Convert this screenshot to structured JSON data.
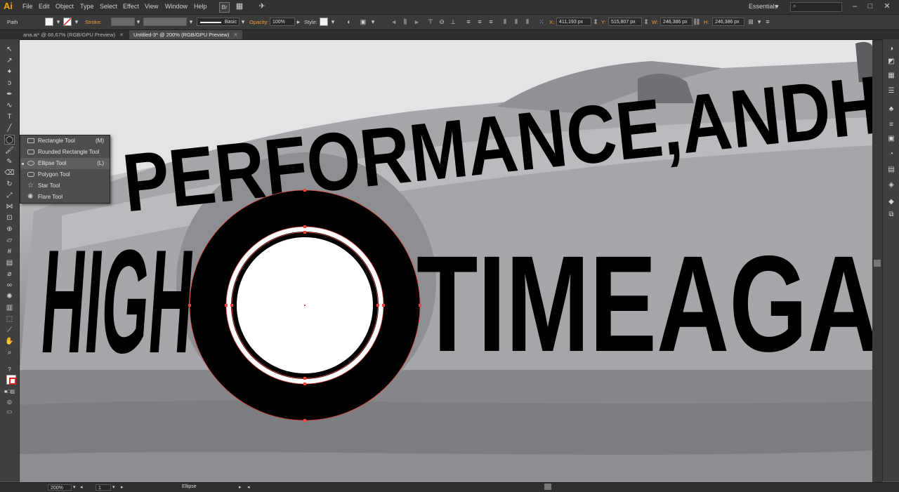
{
  "app": {
    "logo": "Ai"
  },
  "menu": [
    "File",
    "Edit",
    "Object",
    "Type",
    "Select",
    "Effect",
    "View",
    "Window",
    "Help"
  ],
  "menubar_extras": {
    "bridge": "Br",
    "workspace": "Essentials",
    "search_placeholder": ""
  },
  "control": {
    "selection_label": "Path",
    "stroke_label": "Stroke:",
    "stroke_style": "Basic",
    "opacity_label": "Opacity:",
    "opacity_value": "100%",
    "style_label": "Style:",
    "x_label": "X:",
    "x_value": "411,193 px",
    "y_label": "Y:",
    "y_value": "515,807 px",
    "w_label": "W:",
    "w_value": "246,386 px",
    "h_label": "H:",
    "h_value": "246,386 px"
  },
  "tabs": [
    {
      "label": "ana.ai* @ 66,67% (RGB/GPU Preview)",
      "active": false
    },
    {
      "label": "Untitled-3* @ 200% (RGB/GPU Preview)",
      "active": true
    }
  ],
  "flyout": [
    {
      "label": "Rectangle Tool",
      "shortcut": "(M)"
    },
    {
      "label": "Rounded Rectangle Tool",
      "shortcut": ""
    },
    {
      "label": "Ellipse Tool",
      "shortcut": "(L)"
    },
    {
      "label": "Polygon Tool",
      "shortcut": ""
    },
    {
      "label": "Star Tool",
      "shortcut": ""
    },
    {
      "label": "Flare Tool",
      "shortcut": ""
    }
  ],
  "artwork": {
    "line1": "PERFORMANCE,ANDHI",
    "line2_left": "HIGH",
    "line2_right": "TIMEAGA"
  },
  "status": {
    "zoom": "200%",
    "page": "1",
    "tool": "Ellipse"
  },
  "colors": {
    "accent": "#f29d38",
    "ui_bg": "#535353",
    "panel_bg": "#404040"
  }
}
